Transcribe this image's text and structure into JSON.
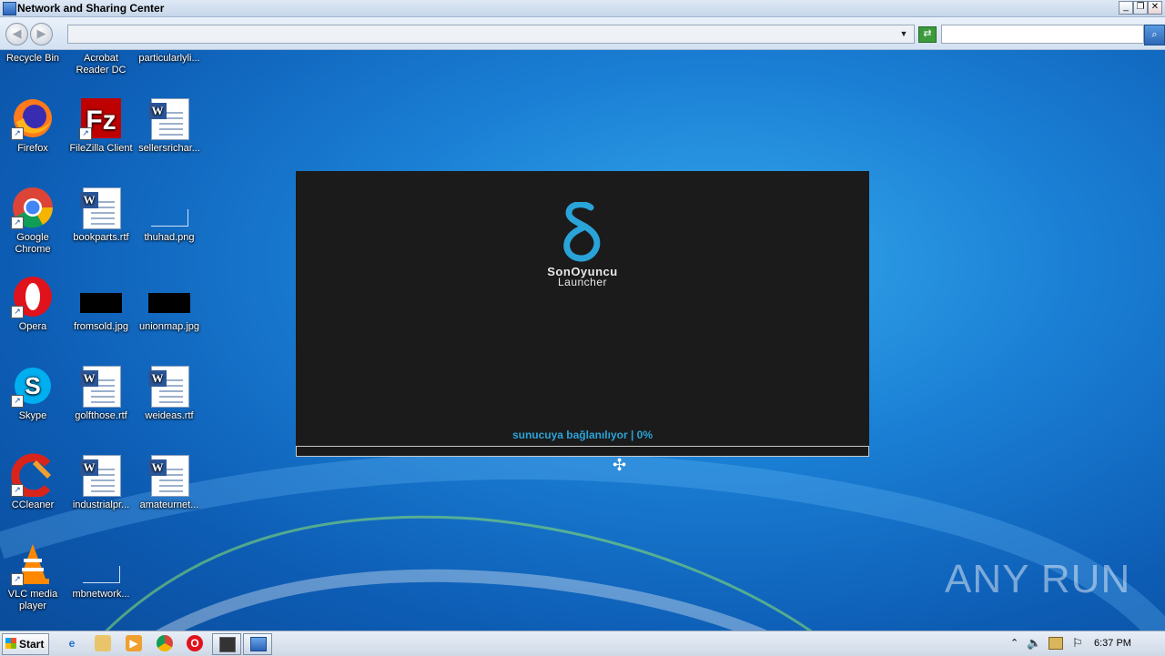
{
  "window": {
    "title": "Network and Sharing Center",
    "minimize": "_",
    "restore": "❐",
    "close": "✕",
    "address_value": "",
    "search_placeholder": ""
  },
  "desktop_icons": {
    "recycle_bin": "Recycle Bin",
    "acrobat": "Acrobat Reader DC",
    "particularly": "particularlyli...",
    "firefox": "Firefox",
    "filezilla": "FileZilla Client",
    "sellers": "sellersrichar...",
    "chrome": "Google Chrome",
    "bookparts": "bookparts.rtf",
    "thuhad": "thuhad.png",
    "opera": "Opera",
    "fromsold": "fromsold.jpg",
    "unionmap": "unionmap.jpg",
    "skype": "Skype",
    "golfthose": "golfthose.rtf",
    "weideas": "weideas.rtf",
    "ccleaner": "CCleaner",
    "industrialpr": "industrialpr...",
    "amateurnet": "amateurnet...",
    "vlc": "VLC media player",
    "mbnetwork": "mbnetwork..."
  },
  "launcher": {
    "brand_line1": "SonOyuncu",
    "brand_line2": "Launcher",
    "status": "sunucuya bağlanılıyor | 0%",
    "progress": 0,
    "accent": "#2aa3d8"
  },
  "watermark": "ANY RUN",
  "taskbar": {
    "start_label": "Start",
    "clock": "6:37 PM"
  }
}
